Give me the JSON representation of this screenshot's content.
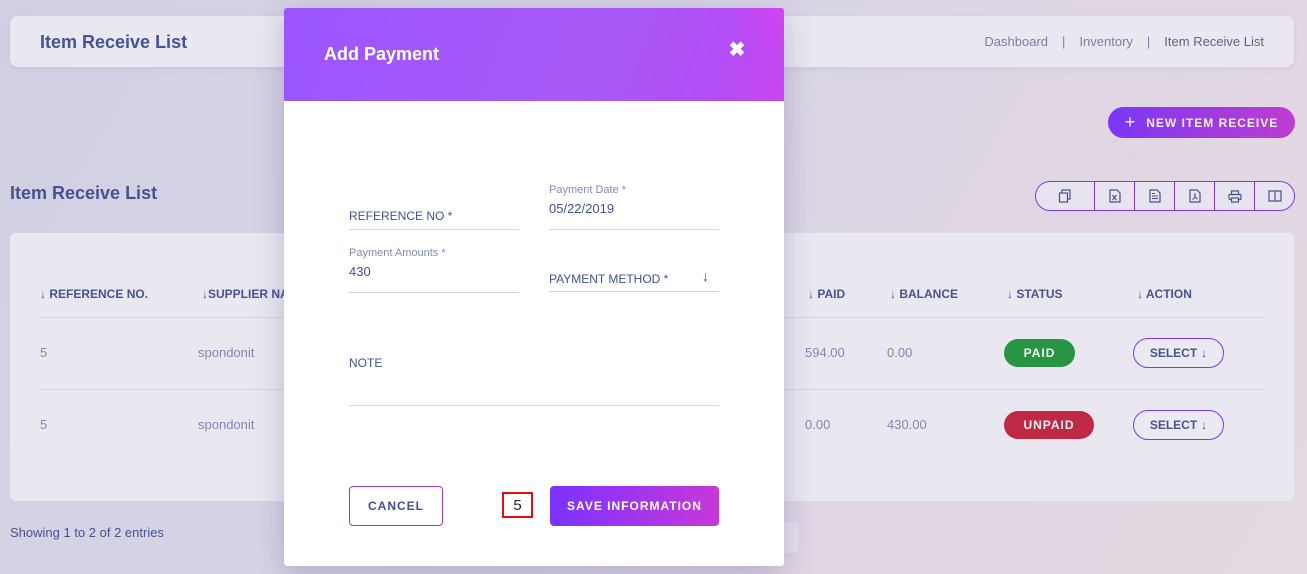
{
  "header": {
    "title": "Item Receive List",
    "breadcrumb": [
      "Dashboard",
      "Inventory",
      "Item Receive List"
    ]
  },
  "new_button_label": "NEW ITEM RECEIVE",
  "list_title": "Item Receive List",
  "export_icons": [
    "copy-icon",
    "excel-icon",
    "csv-icon",
    "pdf-icon",
    "print-icon",
    "columns-icon"
  ],
  "table": {
    "columns": [
      "REFERENCE NO.",
      "SUPPLIER NA",
      "PAID",
      "BALANCE",
      "STATUS",
      "ACTION"
    ],
    "rows": [
      {
        "ref": "5",
        "supplier": "spondonit",
        "paid": "594.00",
        "balance": "0.00",
        "status": "PAID",
        "action": "SELECT"
      },
      {
        "ref": "5",
        "supplier": "spondonit",
        "paid": "0.00",
        "balance": "430.00",
        "status": "UNPAID",
        "action": "SELECT"
      }
    ]
  },
  "showing_text": "Showing 1 to 2 of 2 entries",
  "modal": {
    "title": "Add Payment",
    "reference_label": "REFERENCE NO *",
    "payment_date_label": "Payment Date *",
    "payment_date_value": "05/22/2019",
    "payment_amount_label": "Payment Amounts *",
    "payment_amount_value": "430",
    "payment_method_label": "PAYMENT METHOD *",
    "note_label": "NOTE",
    "cancel_label": "CANCEL",
    "save_label": "SAVE INFORMATION",
    "marker_label": "5"
  },
  "colors": {
    "accent_start": "#7c32ff",
    "accent_end": "#c738d8",
    "paid": "#1f9a3a",
    "unpaid": "#c8223a",
    "text": "#415094"
  }
}
